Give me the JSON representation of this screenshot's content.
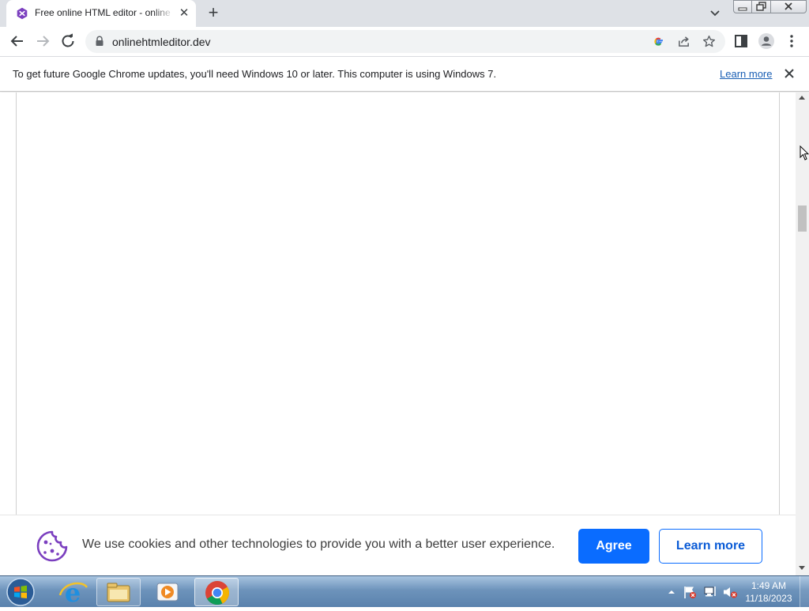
{
  "browser": {
    "tab_title": "Free online HTML editor - online HTML editor",
    "url": "onlinehtmleditor.dev"
  },
  "infobar": {
    "message": "To get future Google Chrome updates, you'll need Windows 10 or later. This computer is using Windows 7.",
    "link_label": "Learn more"
  },
  "cookie_banner": {
    "message": "We use cookies and other technologies to provide you with a better user experience.",
    "agree_label": "Agree",
    "learn_more_label": "Learn more"
  },
  "taskbar": {
    "time": "1:49 AM",
    "date": "11/18/2023"
  },
  "colors": {
    "accent_blue": "#0a6cff",
    "favicon_purple": "#7b3fbf"
  }
}
